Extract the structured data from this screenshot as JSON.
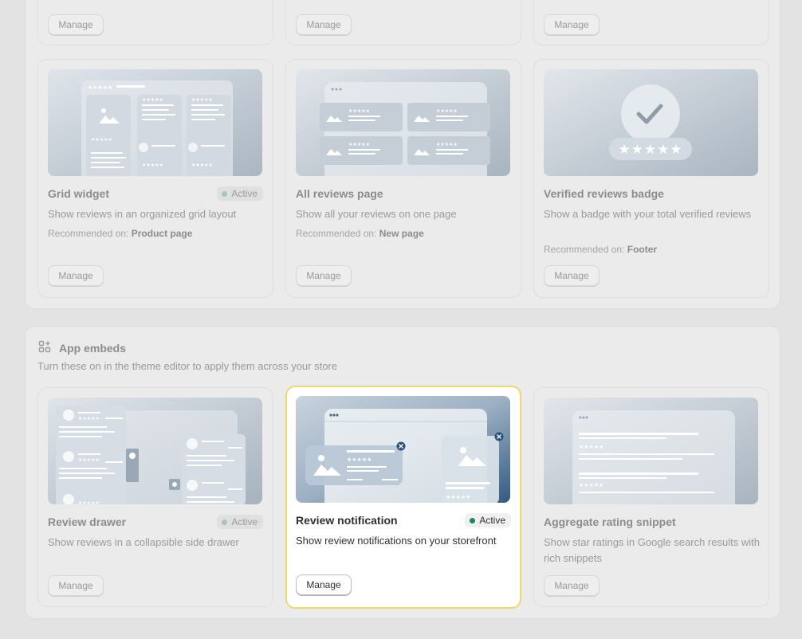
{
  "top_cards": [
    {
      "manage_label": "Manage"
    },
    {
      "manage_label": "Manage"
    },
    {
      "manage_label": "Manage"
    }
  ],
  "widgets": [
    {
      "title": "Grid widget",
      "badge": "Active",
      "description": "Show reviews in an organized grid layout",
      "recommended_prefix": "Recommended on:",
      "recommended_value": "Product page",
      "manage_label": "Manage"
    },
    {
      "title": "All reviews page",
      "description": "Show all your reviews on one page",
      "recommended_prefix": "Recommended on:",
      "recommended_value": "New page",
      "manage_label": "Manage"
    },
    {
      "title": "Verified reviews badge",
      "description": "Show a badge with your total verified reviews",
      "recommended_prefix": "Recommended on:",
      "recommended_value": "Footer",
      "manage_label": "Manage"
    }
  ],
  "app_embeds": {
    "title": "App embeds",
    "subtitle": "Turn these on in the theme editor to apply them across your store",
    "cards": [
      {
        "title": "Review drawer",
        "badge": "Active",
        "description": "Show reviews in a collapsible side drawer",
        "manage_label": "Manage"
      },
      {
        "title": "Review notification",
        "badge": "Active",
        "description": "Show review notifications on your storefront",
        "manage_label": "Manage"
      },
      {
        "title": "Aggregate rating snippet",
        "description": "Show star ratings in Google search results with rich snippets",
        "manage_label": "Manage"
      }
    ]
  },
  "colors": {
    "active_dot": "#1a8a5a",
    "highlight_border": "#ecd86c"
  },
  "icons": [
    "apps-add-icon",
    "checkmark-icon",
    "image-icon",
    "close-icon",
    "star-icon"
  ]
}
